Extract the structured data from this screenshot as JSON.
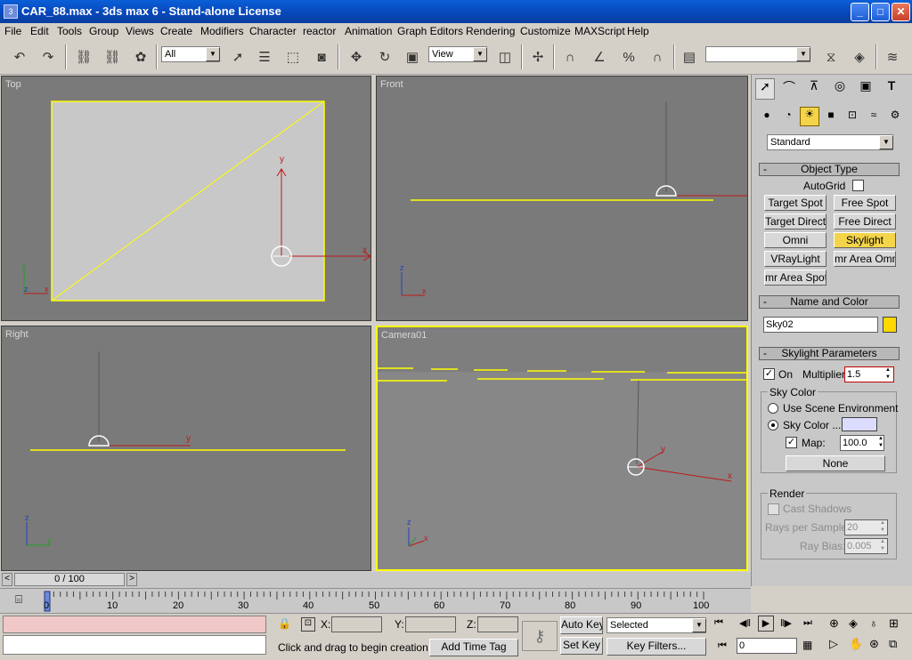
{
  "window": {
    "title": "CAR_88.max - 3ds max 6 - Stand-alone License",
    "app_icon_label": "3",
    "minimize": "_",
    "maximize": "□",
    "close": "✕"
  },
  "menu": [
    "File",
    "Edit",
    "Tools",
    "Group",
    "Views",
    "Create",
    "Modifiers",
    "Character",
    "reactor",
    "Animation",
    "Graph Editors",
    "Rendering",
    "Customize",
    "MAXScript",
    "Help"
  ],
  "toolbar": {
    "selection_filter": "All",
    "reference_coord": "View",
    "named_selection": "",
    "icons": [
      "undo-icon",
      "redo-icon",
      "select-and-link-icon",
      "unlink-icon",
      "bind-space-warp-icon",
      "select-object-icon",
      "select-by-name-icon",
      "rectangular-selection-icon",
      "window-crossing-icon",
      "select-move-icon",
      "select-rotate-icon",
      "select-scale-icon",
      "pivot-center-icon",
      "manipulate-icon",
      "snap-3d-icon",
      "angle-snap-icon",
      "percent-snap-icon",
      "spinner-snap-icon",
      "edit-named-selections-icon",
      "mirror-icon",
      "align-icon",
      "layer-manager-icon"
    ]
  },
  "viewports": {
    "top": {
      "label": "Top"
    },
    "front": {
      "label": "Front"
    },
    "right": {
      "label": "Right"
    },
    "camera": {
      "label": "Camera01"
    }
  },
  "axis": {
    "x": "x",
    "y": "y",
    "z": "z"
  },
  "command_panel": {
    "tab_icons": [
      "create-tab-icon",
      "modify-tab-icon",
      "hierarchy-tab-icon",
      "motion-tab-icon",
      "display-tab-icon",
      "utilities-tab-icon"
    ],
    "category_icons": [
      "geometry-icon",
      "shapes-icon",
      "lights-icon",
      "cameras-icon",
      "helpers-icon",
      "space-warps-icon",
      "systems-icon"
    ],
    "category_dropdown": "Standard",
    "object_type": {
      "title": "Object Type",
      "autogrid_label": "AutoGrid",
      "buttons": [
        "Target Spot",
        "Free Spot",
        "Target Direct",
        "Free Direct",
        "Omni",
        "Skylight",
        "VRayLight",
        "mr Area Omni",
        "mr Area Spot"
      ],
      "active": "Skylight"
    },
    "name_and_color": {
      "title": "Name and Color",
      "name": "Sky02",
      "color": "#ffd800"
    },
    "skylight_params": {
      "title": "Skylight Parameters",
      "on_label": "On",
      "on_checked": "✓",
      "multiplier_label": "Multiplier:",
      "multiplier": "1.5",
      "sky_color_group": "Sky Color",
      "use_scene_env": "Use Scene Environment",
      "sky_color_label": "Sky Color ...",
      "sky_color_swatch": "#dcdcff",
      "map_label": "Map:",
      "map_checked": "✓",
      "map_value": "100.0",
      "map_button": "None",
      "render_group": "Render",
      "cast_shadows": "Cast Shadows",
      "rays_label": "Rays per Sample:",
      "rays_value": "20",
      "ray_bias_label": "Ray Bias:",
      "ray_bias_value": "0.005"
    }
  },
  "timeline": {
    "slider_label": "0 / 100",
    "left_arrow": "<",
    "right_arrow": ">",
    "ticks": [
      "0",
      "10",
      "20",
      "30",
      "40",
      "50",
      "60",
      "70",
      "80",
      "90",
      "100"
    ]
  },
  "status": {
    "x_label": "X:",
    "y_label": "Y:",
    "z_label": "Z:",
    "prompt": "Click and drag to begin creation pro",
    "add_time_tag": "Add Time Tag",
    "auto_key": "Auto Key",
    "set_key": "Set Key",
    "selected": "Selected",
    "key_filters": "Key Filters...",
    "frame": "0"
  }
}
